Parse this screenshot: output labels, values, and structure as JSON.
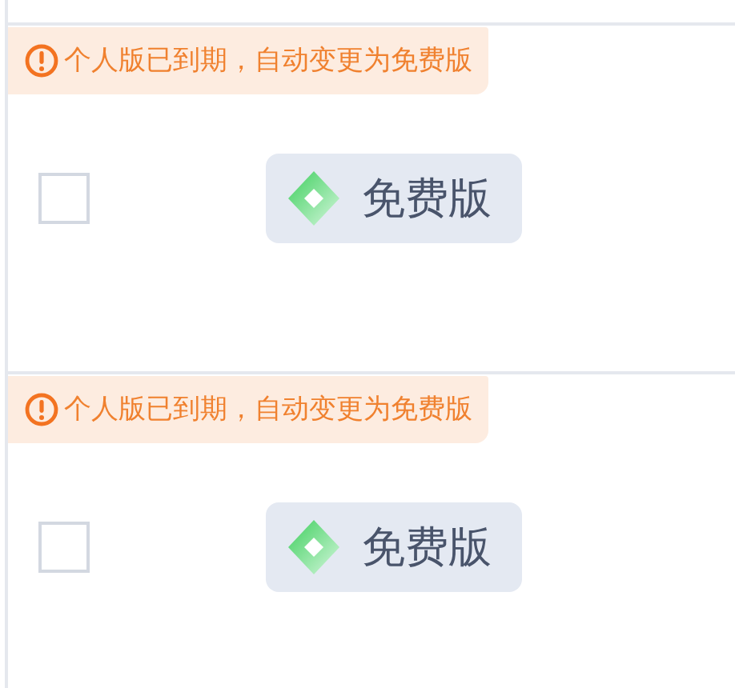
{
  "rows": [
    {
      "notice": "个人版已到期，自动变更为免费版",
      "checked": false,
      "plan": "免费版"
    },
    {
      "notice": "个人版已到期，自动变更为免费版",
      "checked": false,
      "plan": "免费版"
    }
  ]
}
